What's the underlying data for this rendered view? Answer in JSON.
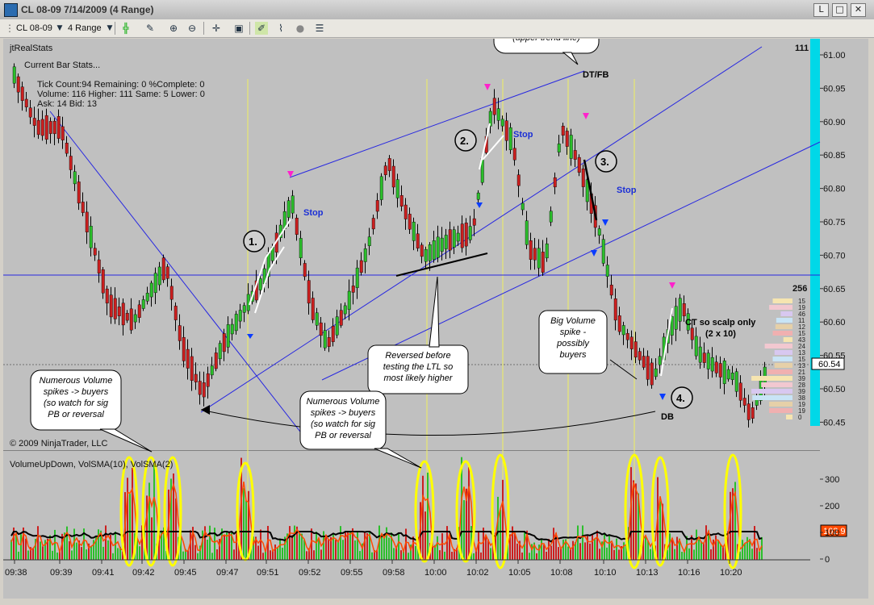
{
  "window": {
    "title": "CL 08-09  7/14/2009 (4 Range)",
    "buttons": {
      "minimize": "L",
      "maximize": "□",
      "close": "✕"
    }
  },
  "toolbar": {
    "instrument": "CL 08-09",
    "interval": "4 Range",
    "icons": [
      "bar-style-icon",
      "draw-tool-icon",
      "zoom-in-icon",
      "zoom-out-icon",
      "crosshair-icon",
      "properties-icon",
      "strategy-icon",
      "indicator-icon",
      "data-box-icon",
      "chart-trader-icon"
    ]
  },
  "chart": {
    "indicator_label": "jtRealStats",
    "stats": {
      "header": "Current Bar Stats...",
      "line1": "Tick Count:94   Remaining: 0   %Complete: 0",
      "line2": "Volume: 116   Higher: 111   Same: 5   Lower: 0",
      "line3": "Ask: 14   Bid: 13"
    },
    "copyright": "© 2009 NinjaTrader, LLC",
    "volume_panel_label": "VolumeUpDown, VolSMA(10), VolSMA(2)",
    "last_price": "60.54",
    "last_volume": "102.9",
    "max_label": "111",
    "vp_value": "256",
    "profile_numbers": [
      "15",
      "19",
      "46",
      "11",
      "12",
      "15",
      "43",
      "24",
      "13",
      "15",
      "13",
      "21",
      "39",
      "28",
      "39",
      "38",
      "19",
      "19",
      "0"
    ],
    "price_axis": [
      "61.00",
      "60.95",
      "60.90",
      "60.85",
      "60.80",
      "60.75",
      "60.70",
      "60.65",
      "60.60",
      "60.55",
      "60.50",
      "60.45"
    ],
    "volume_axis": [
      "300",
      "200",
      "100",
      "0"
    ],
    "time_axis": [
      "09:38",
      "09:39",
      "09:41",
      "09:42",
      "09:45",
      "09:47",
      "09:51",
      "09:52",
      "09:55",
      "09:58",
      "10:00",
      "10:02",
      "10:05",
      "10:08",
      "10:10",
      "10:13",
      "10:16",
      "10:20"
    ],
    "annotations": {
      "failed_retest": "Failed retest of UTL (upper trend line)",
      "dtfb": "DT/FB",
      "reversed": "Reversed before testing the LTL so most likely higher",
      "big_volume": "Big Volume spike - possibly buyers",
      "ct_scalp": "CT so scalp only (2 x 10)",
      "numerous_1": "Numerous Volume spikes -> buyers (so watch for sig PB or reversal",
      "numerous_2": "Numerous Volume spikes -> buyers (so watch for sig PB or reversal",
      "db": "DB",
      "stop": "Stop",
      "circles": [
        "1.",
        "2.",
        "3.",
        "4."
      ]
    }
  },
  "colors": {
    "bull_bar": "#2bbf2b",
    "bear_bar": "#cc1f1f",
    "trendline": "#2828e0",
    "vertical_marker": "#f0f060",
    "volume_highlight": "#ffff00",
    "sma_fast": "#ff4a00",
    "sma_slow": "#000000",
    "right_bar": "#00d8e8"
  }
}
